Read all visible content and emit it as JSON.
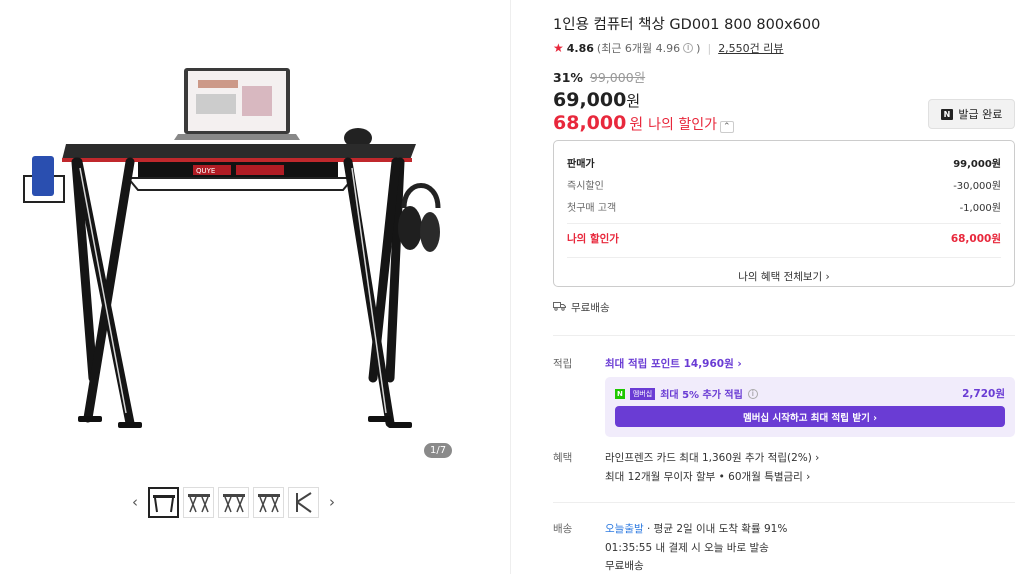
{
  "gallery": {
    "counter": "1/7",
    "thumbnail_count": 5,
    "prev_label": "‹",
    "next_label": "›"
  },
  "product": {
    "title": "1인용 컴퓨터 책상 GD001 800 800x600",
    "rating": "4.86",
    "rating_recent": "(최근 6개월 4.96",
    "rating_recent_close": ")",
    "reviews": "2,550건 리뷰",
    "discount_pct": "31%",
    "original_price": "99,000원",
    "price": "69,000",
    "price_unit": "원",
    "my_price": "68,000",
    "my_price_unit": "원",
    "my_price_label": "나의 할인가",
    "coupon_button": "발급 완료",
    "coupon_badge": "N"
  },
  "breakdown": {
    "rows": [
      {
        "label": "판매가",
        "value": "99,000원"
      },
      {
        "label": "즉시할인",
        "value": "-30,000원"
      },
      {
        "label": "첫구매 고객",
        "value": "-1,000원"
      }
    ],
    "total_label": "나의 할인가",
    "total_value": "68,000원",
    "benefits_link": "나의 혜택 전체보기 ›"
  },
  "shipping_free_top": "무료배송",
  "points": {
    "label": "적립",
    "max_points": "최대 적립 포인트 14,960원 ›",
    "member_badge_n": "N",
    "member_badge_text": "멤버십",
    "member_text": "최대 5% 추가 적립",
    "member_amount": "2,720원",
    "member_cta": "멤버십 시작하고 최대 적립 받기 ›"
  },
  "benefits": {
    "label": "혜택",
    "line1": "라인프렌즈 카드 최대 1,360원 추가 적립(2%) ›",
    "line2": "최대 12개월 무이자 할부 • 60개월 특별금리 ›"
  },
  "delivery": {
    "label": "배송",
    "fast": "오늘출발",
    "fast_note": "· 평균 2일 이내 도착 확률 91%",
    "timer": "01:35:55  내 결제 시 오늘 바로 발송",
    "free": "무료배송"
  },
  "colors": {
    "accent_red": "#e8283c",
    "member_purple": "#6a3cd4"
  }
}
